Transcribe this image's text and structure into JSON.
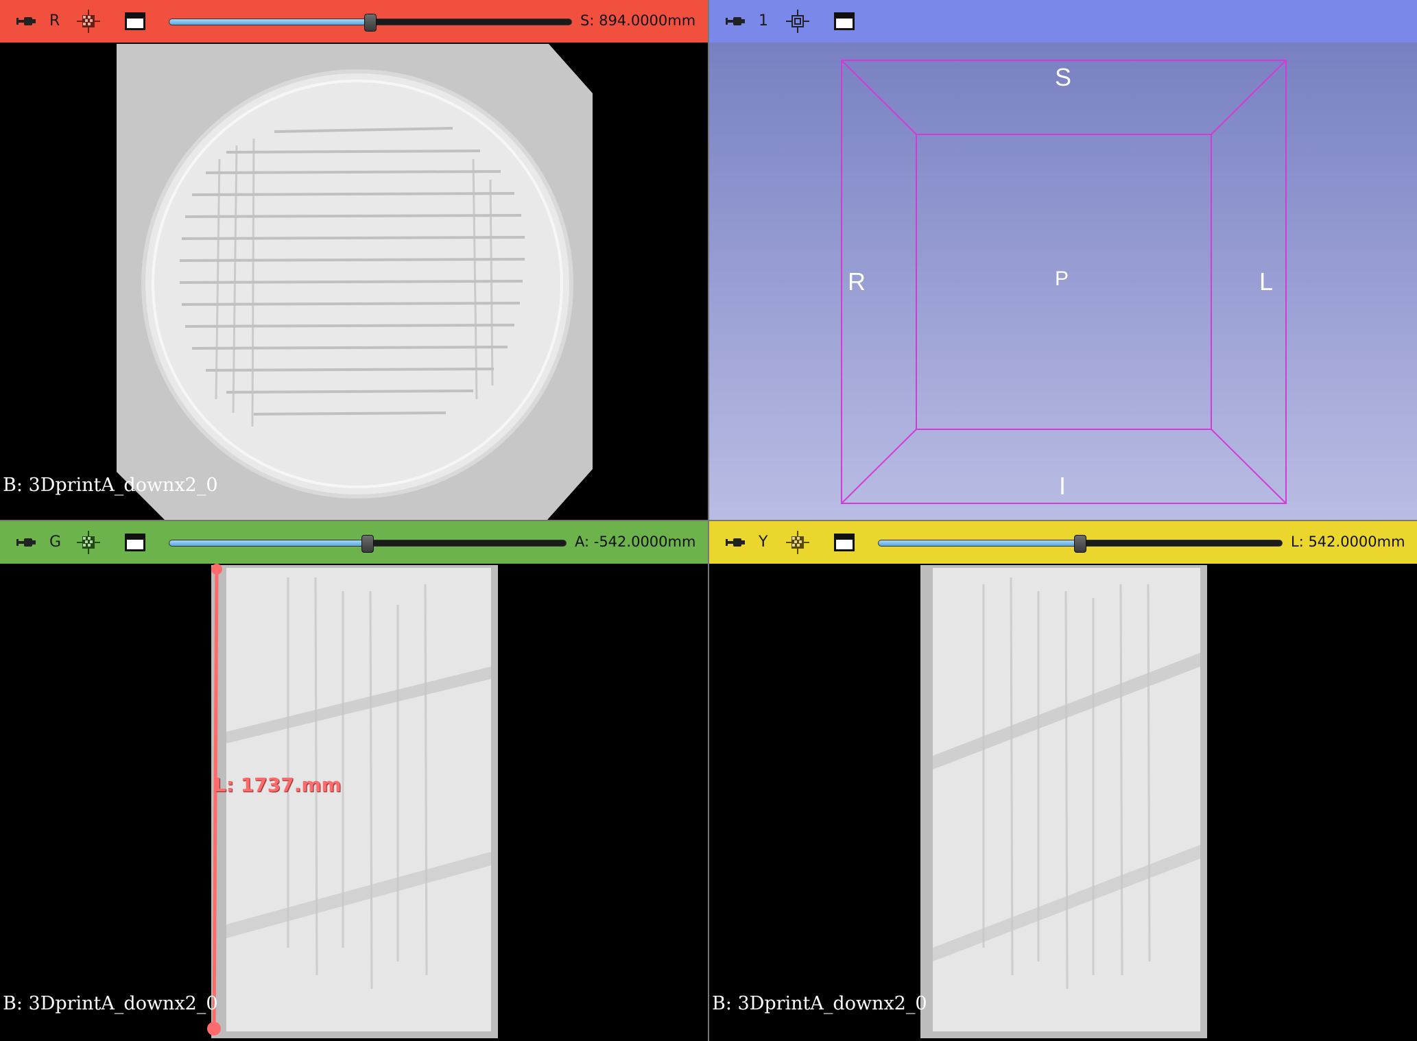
{
  "views": {
    "red": {
      "label": "R",
      "offset": "S: 894.0000mm",
      "slider_fraction": 0.5,
      "caption": "B: 3DprintA_downx2_0",
      "color": "#f2503e"
    },
    "threed": {
      "label": "1",
      "color": "#7a89e9",
      "orientation": {
        "top": "S",
        "bottom": "I",
        "left": "R",
        "right": "L",
        "center": "P"
      }
    },
    "green": {
      "label": "G",
      "offset": "A: -542.0000mm",
      "slider_fraction": 0.5,
      "caption": "B: 3DprintA_downx2_0",
      "color": "#6cb34c",
      "measurement": "L: 1737.mm"
    },
    "yellow": {
      "label": "Y",
      "offset": "L: 542.0000mm",
      "slider_fraction": 0.5,
      "caption": "B: 3DprintA_downx2_0",
      "color": "#ebd62e"
    }
  },
  "icons": {
    "pin": "pin-icon",
    "layers": "slice-layers-icon",
    "center": "center-view-icon",
    "window": "maximize-view-icon"
  }
}
